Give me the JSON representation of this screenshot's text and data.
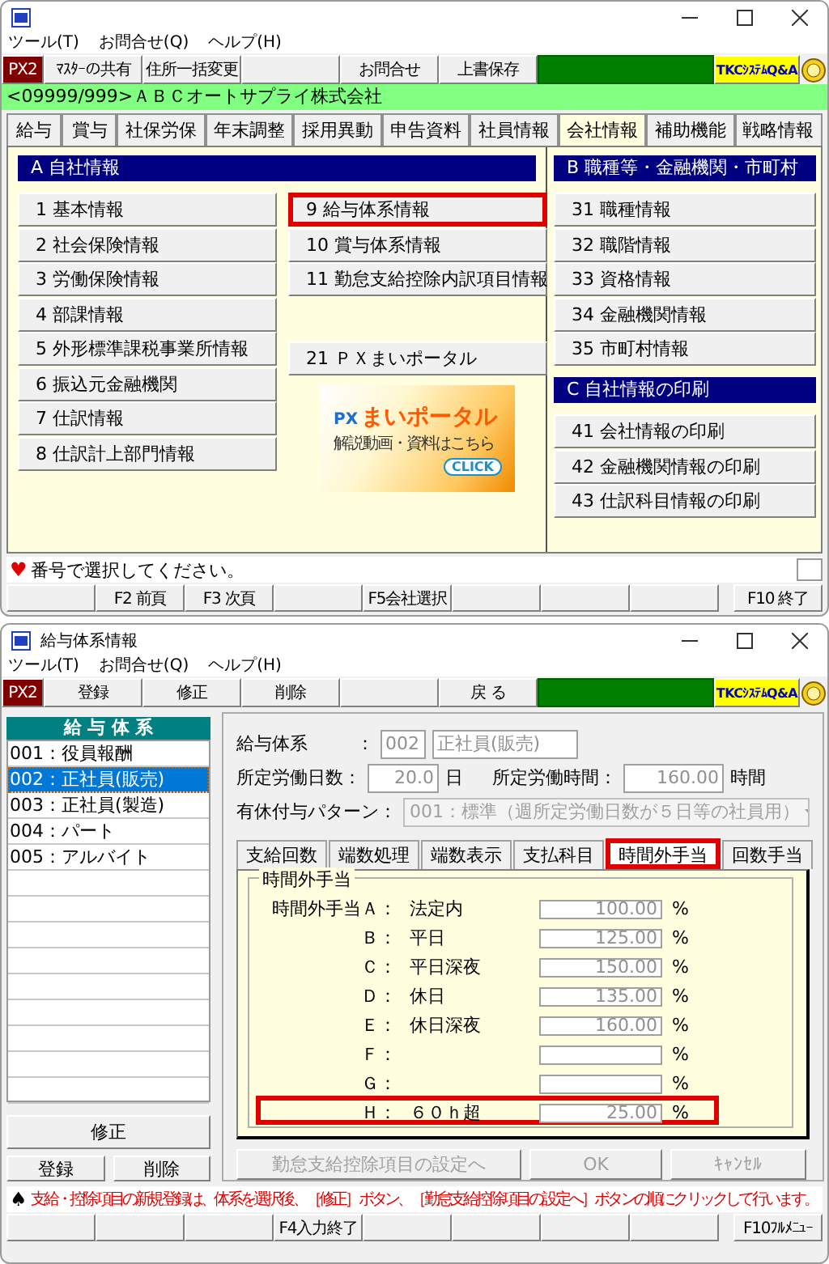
{
  "top_window": {
    "menu": [
      "ツール(T)",
      "お問合せ(Q)",
      "ヘルプ(H)"
    ],
    "toolbar": [
      {
        "kind": "brand",
        "label": "PX2"
      },
      {
        "kind": "button",
        "label": "ﾏｽﾀｰの共有"
      },
      {
        "kind": "button",
        "label": "住所一括変更"
      },
      {
        "kind": "blank"
      },
      {
        "kind": "button",
        "label": "お問合せ"
      },
      {
        "kind": "button",
        "label": "上書保存"
      },
      {
        "kind": "status"
      },
      {
        "kind": "qa",
        "label": "TKCｼｽﾃﾑQ&A"
      },
      {
        "kind": "emblem"
      }
    ],
    "company": "<09999/999>ＡＢＣオートサプライ株式会社",
    "tabs": [
      {
        "label": "給与",
        "selected": false
      },
      {
        "label": "賞与",
        "selected": false
      },
      {
        "label": "社保労保",
        "selected": false
      },
      {
        "label": "年末調整",
        "selected": false
      },
      {
        "label": "採用異動",
        "selected": false
      },
      {
        "label": "申告資料",
        "selected": false
      },
      {
        "label": "社員情報",
        "selected": false
      },
      {
        "label": "会社情報",
        "selected": true
      },
      {
        "label": "補助機能",
        "selected": false
      },
      {
        "label": "戦略情報",
        "selected": false
      }
    ],
    "section_a": {
      "title": "A 自社情報",
      "columns": [
        [
          {
            "label": "1 基本情報",
            "highlighted": false
          },
          {
            "label": "2 社会保険情報",
            "highlighted": false
          },
          {
            "label": "3 労働保険情報",
            "highlighted": false
          },
          {
            "label": "4 部課情報",
            "highlighted": false
          },
          {
            "label": "5 外形標準課税事業所情報",
            "highlighted": false
          },
          {
            "label": "6 振込元金融機関",
            "highlighted": false
          },
          {
            "label": "7 仕訳情報",
            "highlighted": false
          },
          {
            "label": "8 仕訳計上部門情報",
            "highlighted": false
          }
        ],
        [
          {
            "label": "9 給与体系情報",
            "highlighted": true
          },
          {
            "label": "10 賞与体系情報",
            "highlighted": false
          },
          {
            "label": "11 勤怠支給控除内訳項目情報",
            "highlighted": false
          }
        ]
      ],
      "portal": {
        "label": "21 ＰＸまいポータル"
      },
      "banner": {
        "logo": "PX",
        "title": "まいポータル",
        "subtitle": "解説動画・資料はこちら",
        "button": "CLICK"
      }
    },
    "section_b": {
      "title": "B 職種等・金融機関・市町村",
      "items": [
        {
          "label": "31 職種情報",
          "highlighted": false
        },
        {
          "label": "32 職階情報",
          "highlighted": false
        },
        {
          "label": "33 資格情報",
          "highlighted": false
        },
        {
          "label": "34 金融機関情報",
          "highlighted": false
        },
        {
          "label": "35 市町村情報",
          "highlighted": false
        }
      ]
    },
    "section_c": {
      "title": "C 自社情報の印刷",
      "items": [
        {
          "label": "41 会社情報の印刷",
          "highlighted": false
        },
        {
          "label": "42 金融機関情報の印刷",
          "highlighted": false
        },
        {
          "label": "43 仕訳科目情報の印刷",
          "highlighted": false
        }
      ]
    },
    "status": {
      "icon": "♥",
      "message": "番号で選択してください。"
    },
    "function_keys": [
      {
        "kind": "blank"
      },
      {
        "kind": "key",
        "label": "F2 前頁"
      },
      {
        "kind": "key",
        "label": "F3 次頁"
      },
      {
        "kind": "blank"
      },
      {
        "kind": "key",
        "label": "F5会社選択"
      },
      {
        "kind": "blank"
      },
      {
        "kind": "blank"
      },
      {
        "kind": "blank"
      },
      {
        "kind": "key",
        "label": "F10 終了"
      }
    ]
  },
  "bottom_window": {
    "title": "給与体系情報",
    "menu": [
      "ツール(T)",
      "お問合せ(Q)",
      "ヘルプ(H)"
    ],
    "toolbar": [
      {
        "kind": "brand",
        "label": "PX2"
      },
      {
        "kind": "button",
        "label": "登録"
      },
      {
        "kind": "button",
        "label": "修正"
      },
      {
        "kind": "button",
        "label": "削除"
      },
      {
        "kind": "blank"
      },
      {
        "kind": "button",
        "label": "戻 る"
      },
      {
        "kind": "status"
      },
      {
        "kind": "qa",
        "label": "TKCｼｽﾃﾑQ&A"
      },
      {
        "kind": "emblem"
      }
    ],
    "list": {
      "header": "給 与 体 系",
      "items": [
        {
          "label": "001：役員報酬",
          "selected": false
        },
        {
          "label": "002：正社員(販売)",
          "selected": true
        },
        {
          "label": "003：正社員(製造)",
          "selected": false
        },
        {
          "label": "004：パート",
          "selected": false
        },
        {
          "label": "005：アルバイト",
          "selected": false
        }
      ],
      "buttons": [
        "修正",
        "登録",
        "削除"
      ]
    },
    "form": {
      "system_label": "給与体系",
      "system_colon": "：",
      "system_code": "002",
      "system_name": "正社員(販売)",
      "days_label": "所定労働日数：",
      "days": "20.0",
      "days_unit": "日",
      "hours_label": "所定労働時間：",
      "hours": "160.00",
      "hours_unit": "時間",
      "pattern_label": "有休付与パターン：",
      "pattern": "001：標準（週所定労働日数が５日等の社員用）"
    },
    "tabs": [
      {
        "label": "支給回数",
        "selected": false,
        "highlighted": false
      },
      {
        "label": "端数処理",
        "selected": false,
        "highlighted": false
      },
      {
        "label": "端数表示",
        "selected": false,
        "highlighted": false
      },
      {
        "label": "支払科目",
        "selected": false,
        "highlighted": false
      },
      {
        "label": "時間外手当",
        "selected": true,
        "highlighted": true
      },
      {
        "label": "回数手当",
        "selected": false,
        "highlighted": false
      }
    ],
    "group_title": "時間外手当",
    "rows": [
      {
        "letter": "時間外手当Ａ：",
        "label": "法定内",
        "value": "100.00",
        "unit": "%",
        "highlighted": false
      },
      {
        "letter": "Ｂ：",
        "label": "平日",
        "value": "125.00",
        "unit": "%",
        "highlighted": false
      },
      {
        "letter": "Ｃ：",
        "label": "平日深夜",
        "value": "150.00",
        "unit": "%",
        "highlighted": false
      },
      {
        "letter": "Ｄ：",
        "label": "休日",
        "value": "135.00",
        "unit": "%",
        "highlighted": false
      },
      {
        "letter": "Ｅ：",
        "label": "休日深夜",
        "value": "160.00",
        "unit": "%",
        "highlighted": false
      },
      {
        "letter": "Ｆ：",
        "unit": "%",
        "highlighted": false
      },
      {
        "letter": "Ｇ：",
        "unit": "%",
        "highlighted": false
      },
      {
        "letter": "Ｈ：",
        "label": "６０ｈ超",
        "value": "25.00",
        "unit": "%",
        "highlighted": true
      }
    ],
    "actions": [
      {
        "label": "勤怠支給控除項目の設定へ",
        "disabled": true
      },
      {
        "label": "OK",
        "disabled": true
      },
      {
        "label": "ｷｬﾝｾﾙ",
        "disabled": true
      }
    ],
    "status": {
      "icon": "♠",
      "message": "支給・控除項目の新規登録は、体系を選択後、［修正］ボタン、［勤怠支給控除項目の設定へ］ボタンの順にクリックして行います。"
    },
    "function_keys": [
      {
        "kind": "blank"
      },
      {
        "kind": "blank"
      },
      {
        "kind": "blank"
      },
      {
        "kind": "key",
        "label": "F4入力終了"
      },
      {
        "kind": "blank"
      },
      {
        "kind": "blank"
      },
      {
        "kind": "blank"
      },
      {
        "kind": "blank"
      },
      {
        "kind": "key",
        "label": "F10ﾌﾙﾒﾆｭｰ"
      }
    ]
  }
}
